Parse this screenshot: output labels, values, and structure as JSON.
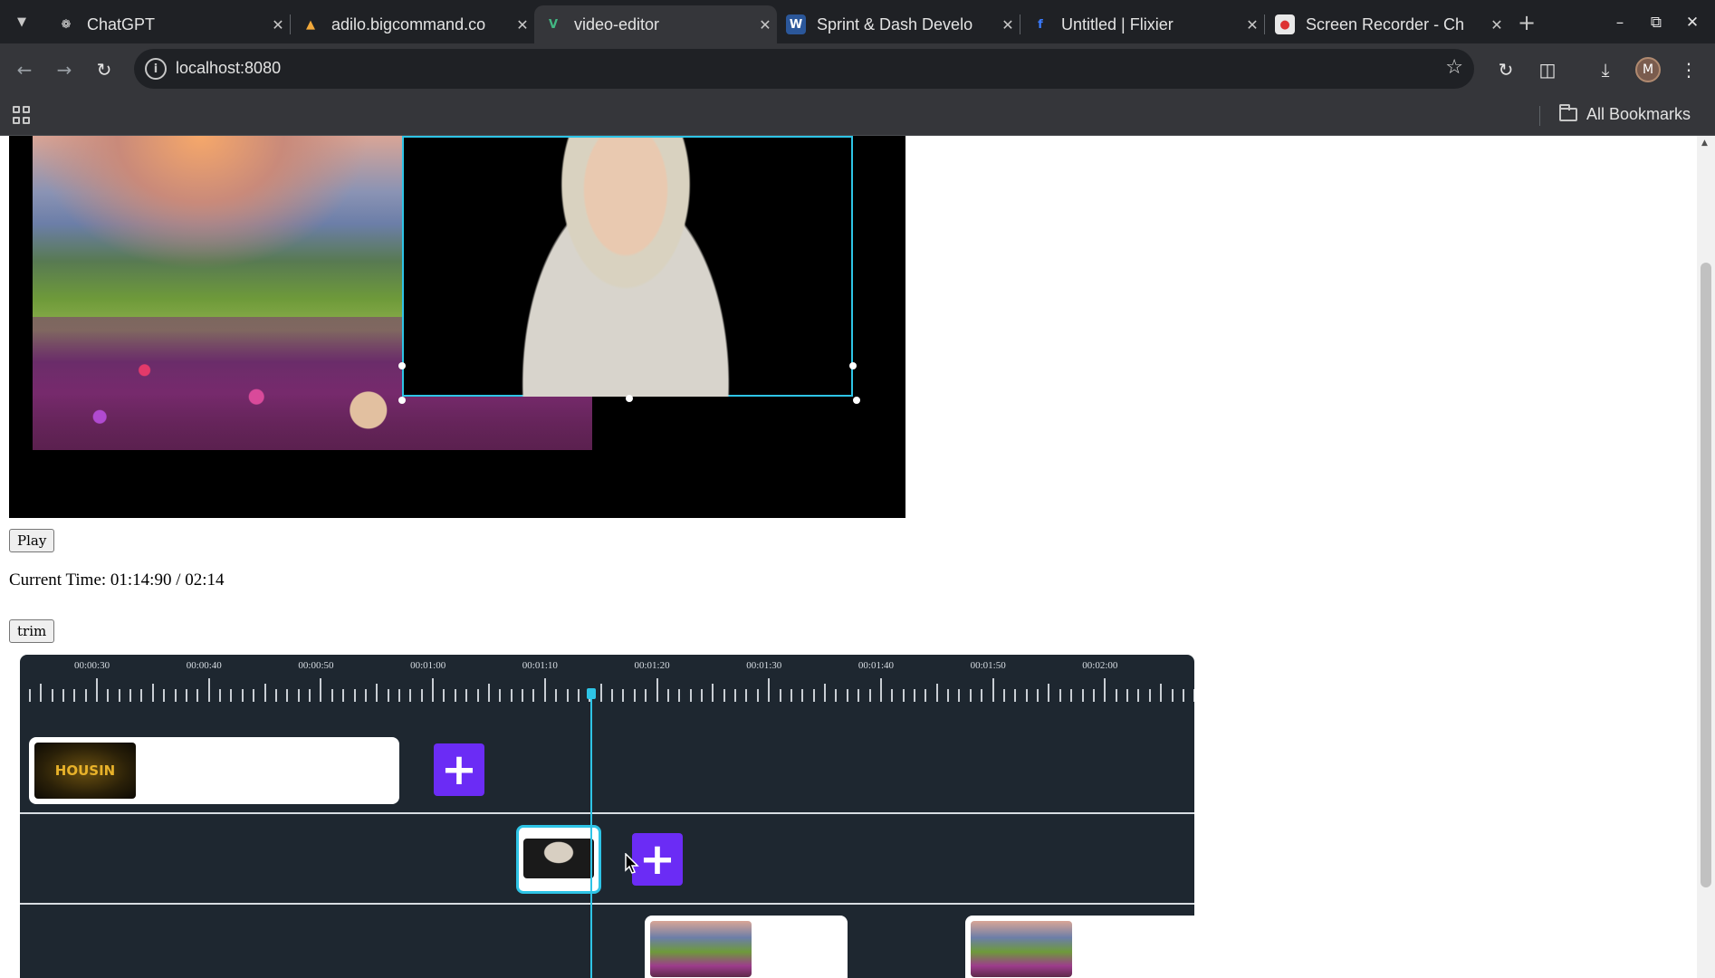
{
  "browser": {
    "tabs": [
      {
        "title": "ChatGPT",
        "favicon": "chatgpt-icon",
        "active": false
      },
      {
        "title": "adilo.bigcommand.co",
        "favicon": "adilo-icon",
        "active": false
      },
      {
        "title": "video-editor",
        "favicon": "vue-icon",
        "active": true
      },
      {
        "title": "Sprint & Dash Develo",
        "favicon": "word-icon",
        "active": false
      },
      {
        "title": "Untitled | Flixier",
        "favicon": "flixier-icon",
        "active": false
      },
      {
        "title": "Screen Recorder - Ch",
        "favicon": "screen-recorder-icon",
        "active": false
      }
    ],
    "url": "localhost:8080",
    "avatar_letter": "M",
    "bookmarks_label": "All Bookmarks"
  },
  "player": {
    "play_label": "Play",
    "current_time_text": "Current Time: 01:14:90 / 02:14",
    "trim_label": "trim"
  },
  "timeline": {
    "tick_labels": [
      "00:00:30",
      "00:00:40",
      "00:00:50",
      "00:01:00",
      "00:01:10",
      "00:01:20",
      "00:01:30",
      "00:01:40",
      "00:01:50",
      "00:02:00"
    ],
    "tracks": [
      {
        "clips": [
          {
            "thumb": "housing-title-thumbnail",
            "text": "HOUSIN"
          }
        ]
      },
      {
        "clips": [
          {
            "thumb": "woman-video-thumbnail"
          }
        ]
      },
      {
        "clips": [
          {
            "thumb": "meadow-image-thumbnail"
          },
          {
            "thumb": "meadow-image-thumbnail"
          }
        ]
      }
    ],
    "add_label": "+"
  },
  "colors": {
    "accent": "#6b2cf5",
    "playhead": "#2ec4e6",
    "timeline_bg": "#1e2730",
    "chrome_dark": "#1f2125",
    "chrome_toolbar": "#35363a"
  }
}
